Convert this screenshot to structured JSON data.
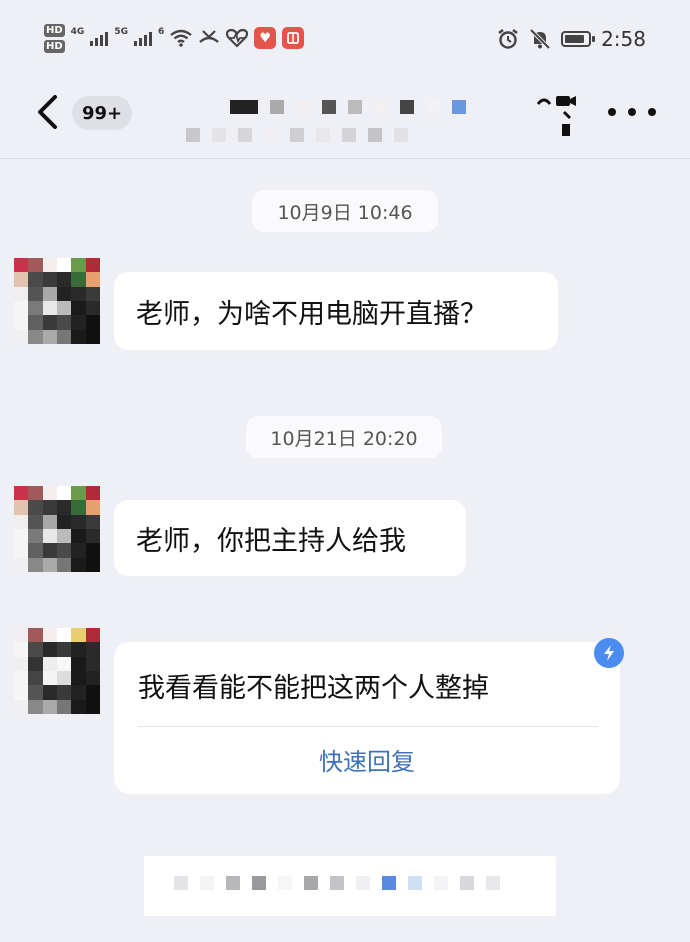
{
  "status_bar": {
    "hd1": "HD",
    "hd2": "HD",
    "net1": "4G",
    "net2": "5G",
    "wifi_gen": "6",
    "time": "2:58",
    "battery_level": 0.9,
    "icons": [
      "hd-icon",
      "signal-icon",
      "wifi-icon",
      "missed-call-icon",
      "heartbeat-icon",
      "app-heart-icon",
      "book-icon",
      "alarm-icon",
      "mute-icon",
      "battery-icon"
    ]
  },
  "header": {
    "unread_count": "99+",
    "title_pixelated": true,
    "icons": [
      "back-icon",
      "video-call-icon",
      "more-icon"
    ]
  },
  "messages": [
    {
      "time": "10月9日 10:46",
      "text": "老师，为啥不用电脑开直播？"
    },
    {
      "time": "10月21日 20:20",
      "text": "老师，你把主持人给我"
    },
    {
      "time": "",
      "text": "我看看能不能把这两个人整掉",
      "action": "快速回复"
    }
  ],
  "colors": {
    "background": "#eff0f5",
    "bubble": "#ffffff",
    "link": "#3f72b8",
    "badge": "#4b8cf0"
  }
}
